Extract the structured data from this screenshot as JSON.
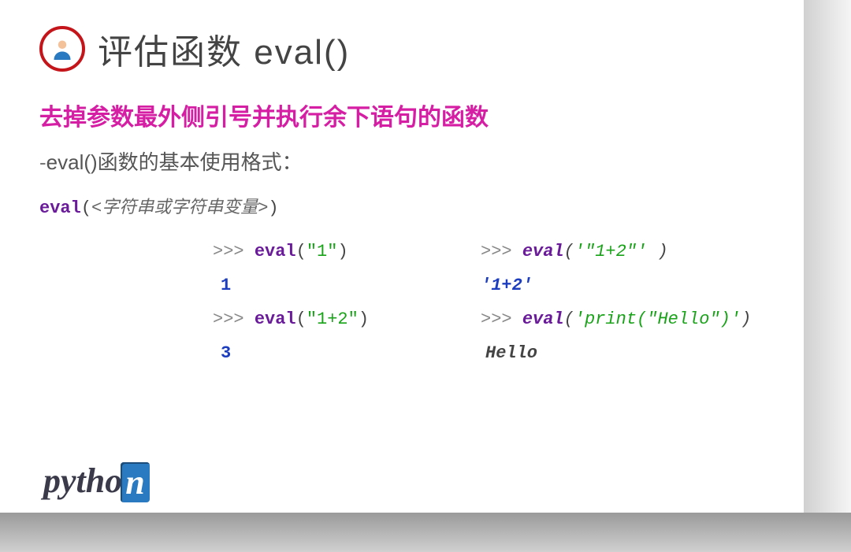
{
  "title": "评估函数 eval()",
  "subtitle": "去掉参数最外侧引号并执行余下语句的函数",
  "usage_dash": "-",
  "usage_text": "eval()函数的基本使用格式：",
  "signature": {
    "fn": "eval",
    "open": "(",
    "arg": "<字符串或字符串变量>",
    "close": ")"
  },
  "prompt": ">>> ",
  "examples": {
    "left": [
      {
        "call_fn": "eval",
        "open": "(",
        "arg": "\"1\"",
        "close": ")",
        "out": "1",
        "out_kind": "num"
      },
      {
        "call_fn": "eval",
        "open": "(",
        "arg": "\"1+2\"",
        "close": ")",
        "out": "3",
        "out_kind": "num"
      }
    ],
    "right": [
      {
        "call_fn": "eval",
        "open": "(",
        "arg": "'\"1+2\"'",
        "close": " )",
        "out": "'1+2'",
        "out_kind": "str"
      },
      {
        "call_fn": "eval",
        "open": "(",
        "arg": "'print(\"Hello\")'",
        "close": ")",
        "out": "Hello",
        "out_kind": "plain"
      }
    ]
  },
  "logo": {
    "pre": "pytho",
    "badge": "n"
  }
}
